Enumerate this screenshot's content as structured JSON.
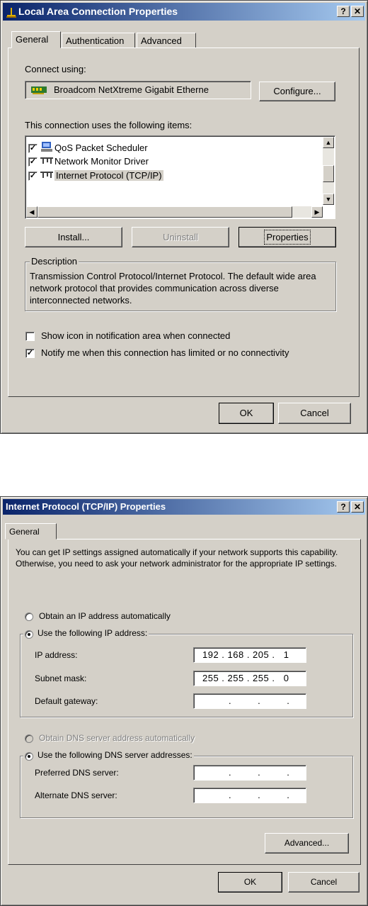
{
  "window1": {
    "title": "Local Area Connection Properties",
    "help_label": "?",
    "close_label": "✕",
    "tabs": [
      {
        "label": "General",
        "active": true
      },
      {
        "label": "Authentication",
        "active": false
      },
      {
        "label": "Advanced",
        "active": false
      }
    ],
    "connect_using_label": "Connect using:",
    "adapter_name": "Broadcom NetXtreme Gigabit Etherne",
    "configure_label": "Configure...",
    "items_label": "This connection uses the following items:",
    "items": [
      {
        "label": "QoS Packet Scheduler",
        "checked": true,
        "icon": "scheduler-icon"
      },
      {
        "label": "Network Monitor Driver",
        "checked": true,
        "icon": "protocol-icon"
      },
      {
        "label": "Internet Protocol (TCP/IP)",
        "checked": true,
        "icon": "protocol-icon",
        "selected": true
      }
    ],
    "install_label": "Install...",
    "uninstall_label": "Uninstall",
    "properties_label": "Properties",
    "description_legend": "Description",
    "description_text": "Transmission Control Protocol/Internet Protocol. The default wide area network protocol that provides communication across diverse interconnected networks.",
    "show_icon_label": "Show icon in notification area when connected",
    "show_icon_checked": false,
    "notify_label": "Notify me when this connection has limited or no connectivity",
    "notify_checked": true,
    "ok_label": "OK",
    "cancel_label": "Cancel"
  },
  "window2": {
    "title": "Internet Protocol (TCP/IP) Properties",
    "help_label": "?",
    "close_label": "✕",
    "tab_label": "General",
    "intro_text": "You can get IP settings assigned automatically if your network supports this capability. Otherwise, you need to ask your network administrator for the appropriate IP settings.",
    "obtain_ip_label": "Obtain an IP address automatically",
    "use_ip_label": "Use the following IP address:",
    "ip_address_label": "IP address:",
    "ip_address_value": "192 . 168 . 205 .   1",
    "subnet_label": "Subnet mask:",
    "subnet_value": "255 . 255 . 255 .   0",
    "gateway_label": "Default gateway:",
    "gateway_value": "         .         .         .",
    "obtain_dns_label": "Obtain DNS server address automatically",
    "use_dns_label": "Use the following DNS server addresses:",
    "preferred_dns_label": "Preferred DNS server:",
    "preferred_dns_value": "         .         .         .",
    "alternate_dns_label": "Alternate DNS server:",
    "alternate_dns_value": "         .         .         .",
    "advanced_label": "Advanced...",
    "ok_label": "OK",
    "cancel_label": "Cancel"
  },
  "colors": {
    "dialog_face": "#d4d0c8",
    "title_start": "#0a246a",
    "title_end": "#a6caf0",
    "selection": "#0a246a"
  }
}
